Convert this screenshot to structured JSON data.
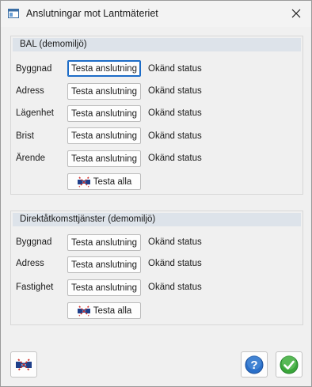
{
  "window": {
    "title": "Anslutningar mot Lantmäteriet",
    "close_symbol": "✕"
  },
  "groups": [
    {
      "header": "BAL (demomiljö)",
      "rows": [
        {
          "label": "Byggnad",
          "button": "Testa anslutning",
          "status": "Okänd status",
          "focused": true
        },
        {
          "label": "Adress",
          "button": "Testa anslutning",
          "status": "Okänd status"
        },
        {
          "label": "Lägenhet",
          "button": "Testa anslutning",
          "status": "Okänd status"
        },
        {
          "label": "Brist",
          "button": "Testa anslutning",
          "status": "Okänd status"
        },
        {
          "label": "Ärende",
          "button": "Testa anslutning",
          "status": "Okänd status"
        }
      ],
      "test_all": "Testa alla"
    },
    {
      "header": "Direktåtkomsttjänster (demomiljö)",
      "rows": [
        {
          "label": "Byggnad",
          "button": "Testa anslutning",
          "status": "Okänd status"
        },
        {
          "label": "Adress",
          "button": "Testa anslutning",
          "status": "Okänd status"
        },
        {
          "label": "Fastighet",
          "button": "Testa anslutning",
          "status": "Okänd status"
        }
      ],
      "test_all": "Testa alla"
    }
  ],
  "footer": {
    "left_icon": "plug-connect-icon",
    "help_icon": "help-icon",
    "ok_icon": "ok-check-icon"
  },
  "colors": {
    "group_header_bg": "#dde3ea",
    "focus_border": "#1c6cc7",
    "help_blue": "#2a6fc9",
    "ok_green": "#3aa63a"
  }
}
